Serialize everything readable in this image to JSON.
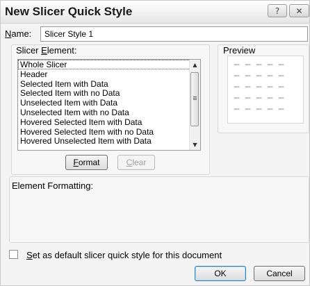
{
  "dialog": {
    "title": "New Slicer Quick Style",
    "help_glyph": "?",
    "close_glyph": "✕"
  },
  "name": {
    "label_accel": "N",
    "label_rest": "ame:",
    "value": "Slicer Style 1"
  },
  "slicer_element": {
    "label_pre": "Slicer ",
    "label_accel": "E",
    "label_rest": "lement:",
    "items": [
      "Whole Slicer",
      "Header",
      "Selected Item with Data",
      "Selected Item with no Data",
      "Unselected Item with Data",
      "Unselected Item with no Data",
      "Hovered Selected Item with Data",
      "Hovered Selected Item with no Data",
      "Hovered Unselected Item with Data"
    ],
    "selected_index": 0,
    "format_accel": "F",
    "format_rest": "ormat",
    "clear_accel": "C",
    "clear_rest": "lear"
  },
  "preview": {
    "label": "Preview",
    "cell_glyph": "«««"
  },
  "element_formatting": {
    "label": "Element Formatting:"
  },
  "default_checkbox": {
    "label_accel": "S",
    "label_rest": "et as default slicer quick style for this document",
    "checked": false
  },
  "buttons": {
    "ok": "OK",
    "cancel": "Cancel"
  }
}
